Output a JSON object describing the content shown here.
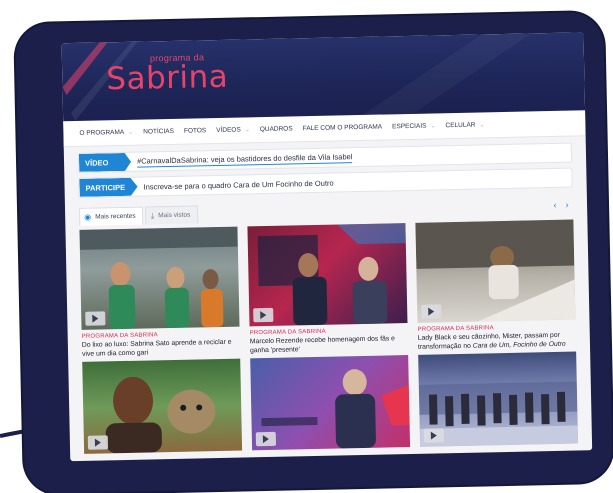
{
  "logo": {
    "small": "programa da",
    "big": "Sabrina"
  },
  "nav": {
    "items": [
      {
        "label": "O PROGRAMA",
        "dropdown": true
      },
      {
        "label": "NOTÍCIAS",
        "dropdown": false
      },
      {
        "label": "FOTOS",
        "dropdown": false
      },
      {
        "label": "VÍDEOS",
        "dropdown": true
      },
      {
        "label": "QUADROS",
        "dropdown": false
      },
      {
        "label": "FALE COM O PROGRAMA",
        "dropdown": false
      },
      {
        "label": "ESPECIAIS",
        "dropdown": true
      },
      {
        "label": "CELULAR",
        "dropdown": true
      }
    ]
  },
  "video_bar": {
    "tag": "VÍDEO",
    "text": "#CarnavalDaSabrina: veja os bastidores do desfile da Vila Isabel"
  },
  "participe_bar": {
    "tag": "PARTICIPE",
    "text": "Inscreva-se para o quadro Cara de Um Focinho de Outro"
  },
  "tabs": [
    {
      "label": "Mais recentes",
      "icon": "eye-icon",
      "active": true
    },
    {
      "label": "Mais vistos",
      "icon": "download-icon",
      "active": false
    }
  ],
  "carousel": {
    "prev": "‹",
    "next": "›"
  },
  "cards": [
    {
      "category": "PROGRAMA DA SABRINA",
      "title": "Do lixo ao luxo: Sabrina Sato aprende a reciclar e vive um dia como gari"
    },
    {
      "category": "PROGRAMA DA SABRINA",
      "title": "Marcelo Rezende recebe homenagem dos fãs e ganha 'presente'"
    },
    {
      "category": "PROGRAMA DA SABRINA",
      "title_pre": "Lady Black e seu cãozinho, Mister, passam por transformação no ",
      "title_em": "Cara de Um, Focinho de Outro"
    },
    {
      "category": "",
      "title": ""
    },
    {
      "category": "",
      "title": ""
    },
    {
      "category": "",
      "title": ""
    }
  ],
  "colors": {
    "brand_pink": "#e8436b",
    "accent_blue": "#1f86d6",
    "header_navy": "#1e2658",
    "frame": "#1b1f4a"
  }
}
